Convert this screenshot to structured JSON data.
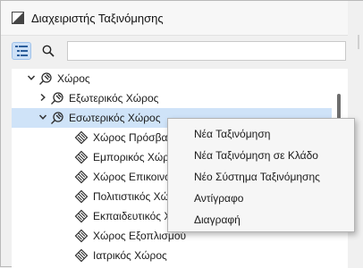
{
  "window": {
    "title": "Διαχειριστής Ταξινόμησης"
  },
  "toolbar": {
    "view_toggle_icon": "tree-view-icon",
    "search_icon": "search-icon",
    "search_value": ""
  },
  "tree": {
    "rows": [
      {
        "label": "Χώρος",
        "level": 0,
        "expanded": true,
        "icon": "classification-system-icon"
      },
      {
        "label": "Εξωτερικός Χώρος",
        "level": 1,
        "expanded": false,
        "icon": "classification-system-icon"
      },
      {
        "label": "Εσωτερικός Χώρος",
        "level": 1,
        "expanded": true,
        "selected": true,
        "icon": "classification-system-icon"
      },
      {
        "label": "Χώρος Πρόσβασης",
        "level": 2,
        "icon": "classification-item-icon"
      },
      {
        "label": "Εμπορικός Χώρος",
        "level": 2,
        "icon": "classification-item-icon"
      },
      {
        "label": "Χώρος Επικοινωνίας",
        "level": 2,
        "icon": "classification-item-icon"
      },
      {
        "label": "Πολιτιστικός Χώρος",
        "level": 2,
        "icon": "classification-item-icon"
      },
      {
        "label": "Εκπαιδευτικός Χώρος",
        "level": 2,
        "icon": "classification-item-icon"
      },
      {
        "label": "Χώρος Εξοπλισμού",
        "level": 2,
        "icon": "classification-item-icon"
      },
      {
        "label": "Ιατρικός Χώρος",
        "level": 2,
        "icon": "classification-item-icon"
      }
    ]
  },
  "context_menu": {
    "items": [
      "Νέα Ταξινόμηση",
      "Νέα Ταξινόμηση σε Κλάδο",
      "Νέο Σύστημα Ταξινόμησης",
      "Αντίγραφο",
      "Διαγραφή"
    ]
  },
  "colors": {
    "selection": "#cfe3f8",
    "accent": "#3d7dc8",
    "icon_stroke": "#2b2b2b"
  }
}
